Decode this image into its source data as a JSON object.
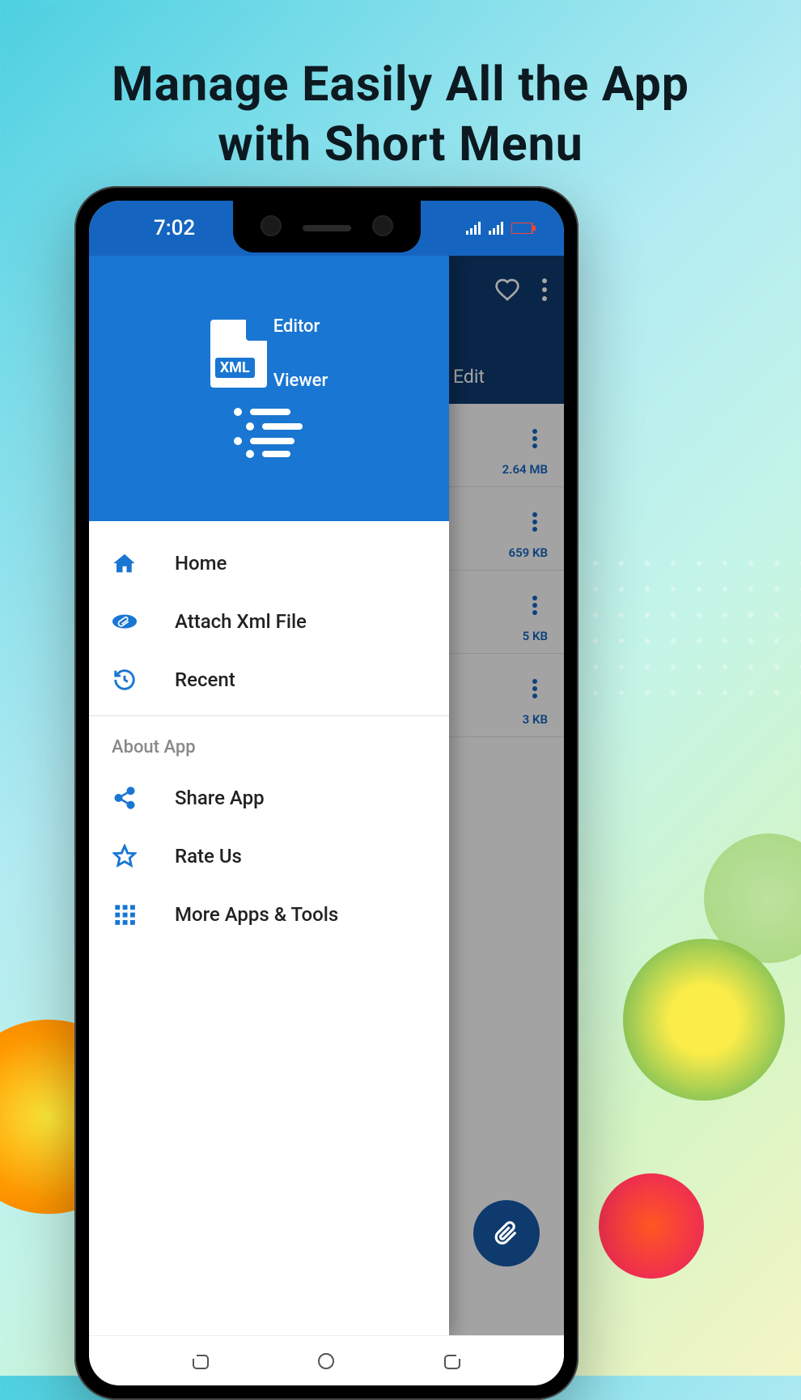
{
  "promo": {
    "title_line1": "Manage Easily All the App",
    "title_line2": "with Short Menu"
  },
  "statusBar": {
    "time": "7:02"
  },
  "appLogo": {
    "badge": "XML",
    "label_top": "Editor",
    "label_bottom": "Viewer"
  },
  "drawer": {
    "main": [
      {
        "icon": "home",
        "label": "Home"
      },
      {
        "icon": "attach",
        "label": "Attach Xml File"
      },
      {
        "icon": "recent",
        "label": "Recent"
      }
    ],
    "sectionTitle": "About App",
    "about": [
      {
        "icon": "share",
        "label": "Share App"
      },
      {
        "icon": "star",
        "label": "Rate Us"
      },
      {
        "icon": "grid",
        "label": "More Apps & Tools"
      }
    ]
  },
  "background": {
    "tabs": {
      "edit": "Edit"
    },
    "files": [
      {
        "size": "2.64 MB"
      },
      {
        "size": "659 KB"
      },
      {
        "size": "5 KB"
      },
      {
        "size": "3 KB"
      }
    ]
  }
}
